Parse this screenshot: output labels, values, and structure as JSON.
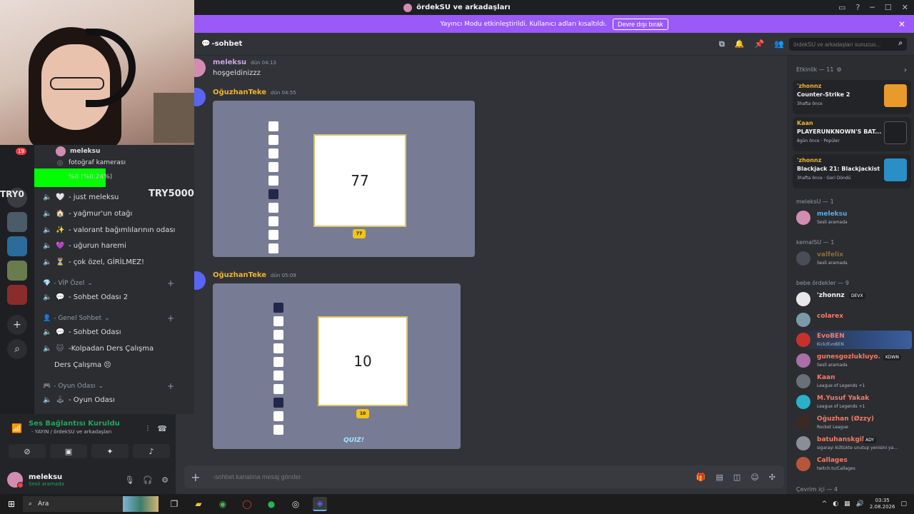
{
  "window": {
    "title": "ördekSU ve arkadaşları",
    "controls": [
      "▭",
      "?",
      "─",
      "☐",
      "✕"
    ]
  },
  "banner": {
    "text": "Yayıncı Modu etkinleştirildi. Kullanıcı adları kısaltıldı.",
    "button": "Devre dışı bırak",
    "close": "✕"
  },
  "overlay": {
    "try_left": "TRY0",
    "try_right": "TRY5000",
    "percent_text": "%0 (%0.24%)",
    "badge_count": "19"
  },
  "channels": {
    "top_user": "meleksu",
    "camera_label": "fotoğraf kamerası",
    "rows": [
      {
        "icon": "🤍",
        "label": "- just meleksu"
      },
      {
        "icon": "🏠",
        "label": "- yağmur'un otağı"
      },
      {
        "icon": "✨",
        "label": "- valorant bağımlılarının odası"
      },
      {
        "icon": "💜",
        "label": "- uğurun haremi"
      },
      {
        "icon": "⏳",
        "label": "- çok özel, GİRİLMEZ!"
      }
    ],
    "categories": [
      {
        "label": "- VİP Özel",
        "items": [
          {
            "icon": "💬",
            "label": "- Sohbet Odası 2"
          }
        ]
      },
      {
        "label": "- Genel Sohbet",
        "items": [
          {
            "icon": "💬",
            "label": "- Sohbet Odası"
          },
          {
            "icon": "🐱",
            "label": "-Kolpadan Ders Çalışma"
          },
          {
            "icon": "",
            "label": "Ders Çalışma 😣"
          }
        ]
      },
      {
        "label": "- Oyun Odası",
        "items": [
          {
            "icon": "🕹",
            "label": "- Oyun Odası"
          }
        ]
      }
    ]
  },
  "voice": {
    "status": "Ses Bağlantısı Kuruldu",
    "channel": "- YAYIN / ördekSU ve arkadaşları"
  },
  "user": {
    "name": "meleksu",
    "status": "Sesli aramada"
  },
  "chat": {
    "channel_name": "-sohbet",
    "search_placeholder": "ördekSU ve arkadaşları sunucus...",
    "input_placeholder": "-sohbet kanalına mesaj gönder",
    "messages": [
      {
        "author": "meleksu",
        "time": "dün 04:13",
        "text": "hoşgeldinizzz",
        "color": "#c9a6e0"
      },
      {
        "author": "OğuzhanTeke",
        "time": "dün 04:55",
        "big_number": "77",
        "pill": "77",
        "color": "#f0b232"
      },
      {
        "author": "OğuzhanTeke",
        "time": "dün 05:09",
        "big_number": "10",
        "pill": "10",
        "logo": "QUIZ!",
        "color": "#f0b232"
      }
    ]
  },
  "members": {
    "activity_header": "Etkinlik — 11",
    "activities": [
      {
        "user": "'zhonnz",
        "game": "Counter-Strike 2",
        "time": "3hafta önce"
      },
      {
        "user": "Kaan",
        "game": "PLAYERUNKNOWN'S BAT...",
        "time": "8gün önce · Popüler"
      },
      {
        "user": "'zhonnz",
        "game": "Blackjack 21: Blackjackist",
        "time": "3hafta önce · Geri Döndü"
      }
    ],
    "groups": [
      {
        "title": "meleksU — 1",
        "list": [
          {
            "name": "meleksu",
            "sub": "Sesli aramada",
            "color": "#5da9e9"
          }
        ]
      },
      {
        "title": "kemalSU — 1",
        "list": [
          {
            "name": "valfelix",
            "sub": "Sesli aramada",
            "color": "#8a6d3b"
          }
        ]
      },
      {
        "title": "bebe ördekler — 9",
        "list": [
          {
            "name": "'zhonnz",
            "sub": "",
            "tag": "DEVX",
            "color": "#f2f3f5"
          },
          {
            "name": "colarex",
            "sub": "",
            "color": "#f47b67"
          },
          {
            "name": "EvoBEN",
            "sub": "Kick/EvoBEN",
            "color": "#f47b67"
          },
          {
            "name": "gunesgozlukluyo...",
            "sub": "Sesli aramada",
            "tag": "KDWN",
            "color": "#f47b67"
          },
          {
            "name": "Kaan",
            "sub": "League of Legends +1",
            "color": "#f47b67"
          },
          {
            "name": "M.Yusuf Yakak",
            "sub": "League of Legends +1",
            "color": "#f47b67"
          },
          {
            "name": "Oğuzhan (Øzzy)",
            "sub": "Rocket League",
            "color": "#f47b67"
          },
          {
            "name": "batuhanskgilu",
            "sub": "sigarayı kültükte unutup yenisini ya...",
            "tag": "ADY",
            "color": "#f47b67"
          },
          {
            "name": "Callages",
            "sub": "twitch.tv/Callages",
            "color": "#f47b67"
          }
        ]
      },
      {
        "title": "Çevrim içi — 4",
        "list": []
      }
    ]
  },
  "taskbar": {
    "search_label": "Ara",
    "time": "03:35",
    "date": "2.08.2026"
  }
}
